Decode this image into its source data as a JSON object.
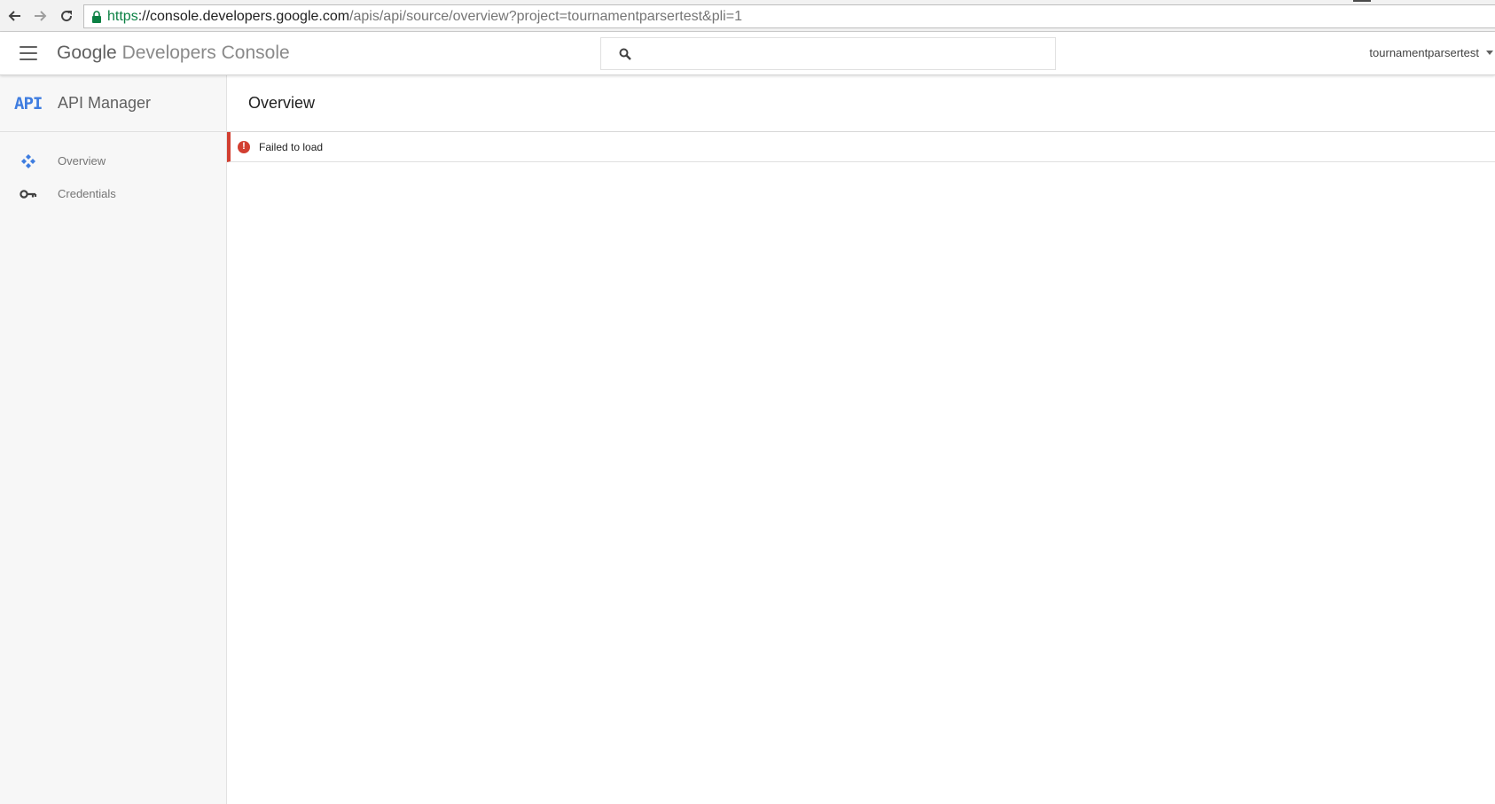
{
  "browser": {
    "url_scheme": "https",
    "url_separator": "://",
    "url_host": "console.developers.google.com",
    "url_path": "/apis/api/source/overview?project=tournamentparsertest&pli=1",
    "icons": [
      "back-arrow-icon",
      "forward-arrow-icon",
      "reload-icon",
      "lock-icon"
    ]
  },
  "header": {
    "brand_google": "Google",
    "brand_product": "Developers Console",
    "search_value": "",
    "project_name": "tournamentparsertest",
    "icons": [
      "hamburger-menu-icon",
      "search-icon",
      "caret-down-icon"
    ]
  },
  "sidebar": {
    "logo_text": "API",
    "title": "API Manager",
    "items": [
      {
        "label": "Overview",
        "icon": "overview-nodes-icon"
      },
      {
        "label": "Credentials",
        "icon": "key-icon"
      }
    ]
  },
  "main": {
    "page_title": "Overview",
    "error_message": "Failed to load",
    "error_icon_glyph": "!"
  },
  "colors": {
    "accent_blue": "#3f7de0",
    "error_red": "#d23f31",
    "secure_green": "#0b8043"
  }
}
